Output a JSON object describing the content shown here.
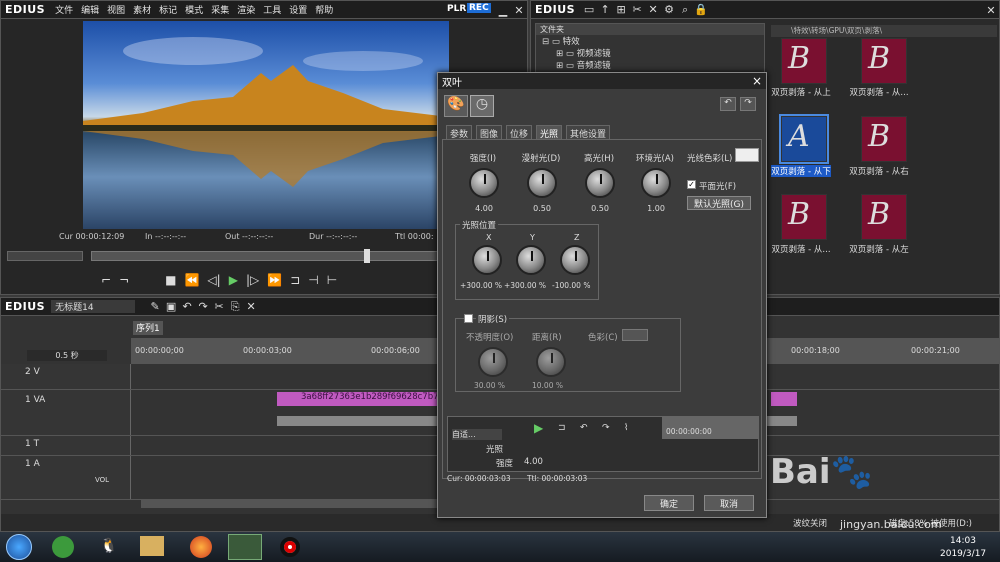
{
  "app": {
    "name": "EDIUS"
  },
  "menu": [
    "文件",
    "编辑",
    "视图",
    "素材",
    "标记",
    "模式",
    "采集",
    "渲染",
    "工具",
    "设置",
    "帮助"
  ],
  "player": {
    "plr": "PLR",
    "rec": "REC",
    "cur": "Cur 00:00:12:09",
    "in": "In --:--:--:--",
    "out": "Out --:--:--:--",
    "dur": "Dur --:--:--:--",
    "ttl": "Ttl 00:00:"
  },
  "bin": {
    "title": "EDIUS",
    "folder_header": "文件夹",
    "path": "\\特效\\转场\\GPU\\双页\\剥落\\",
    "tree": [
      "特效",
      "视频滤镜",
      "音频滤镜"
    ],
    "thumbs": [
      "双页剥落 - 从上",
      "双页剥落 - 从...",
      "双页剥落 - 从下",
      "双页剥落 - 从右",
      "双页剥落 - 从...",
      "双页剥落 - 从左"
    ]
  },
  "timeline": {
    "title": "EDIUS",
    "project": "无标题14",
    "sequence": "序列1",
    "zoom": "0.5 秒",
    "ruler": [
      "00:00:00;00",
      "00:00:03;00",
      "00:00:06;00",
      "00:00:18;00",
      "00:00:21;00"
    ],
    "tracks": [
      "2 V",
      "1 VA",
      "1 T",
      "1 A"
    ],
    "vol": "VOL",
    "clip_name": "3a68ff27363e1b289f69628c7b7f"
  },
  "dialog": {
    "title": "双叶",
    "close": "×",
    "tabs": [
      "参数",
      "图像",
      "位移",
      "光照",
      "其他设置"
    ],
    "light": {
      "strength_label": "强度(I)",
      "diffuse_label": "漫射光(D)",
      "highlight_label": "高光(H)",
      "ambient_label": "环境光(A)",
      "color_label": "光线色彩(L)",
      "strength": "4.00",
      "diffuse": "0.50",
      "highlight": "0.50",
      "ambient": "1.00",
      "parallel": "平面光(F)",
      "default_btn": "默认光照(G)"
    },
    "position": {
      "group": "光照位置",
      "x_label": "X",
      "y_label": "Y",
      "z_label": "Z",
      "x": "+300.00 %",
      "y": "+300.00 %",
      "z": "-100.00 %"
    },
    "shadow": {
      "group": "阴影(S)",
      "opacity_label": "不透明度(O)",
      "distance_label": "距离(R)",
      "color_label": "色彩(C)",
      "opacity": "30.00 %",
      "distance": "10.00 %"
    },
    "keyframe": {
      "mode": "自适...",
      "row1": "光照",
      "row2": "强度",
      "row2_val": "4.00",
      "tc": "00:00:00:00",
      "cur": "Cur: 00:00:03:03",
      "ttl": "Ttl: 00:00:03:03"
    },
    "ok": "确定",
    "cancel": "取消"
  },
  "status": {
    "left": "波纹关闭",
    "right": "磁盘:58% 被使用(D:)"
  },
  "watermark": {
    "site": "jingyan.baidu.com"
  },
  "clock": {
    "time": "14:03",
    "date": "2019/3/17"
  }
}
